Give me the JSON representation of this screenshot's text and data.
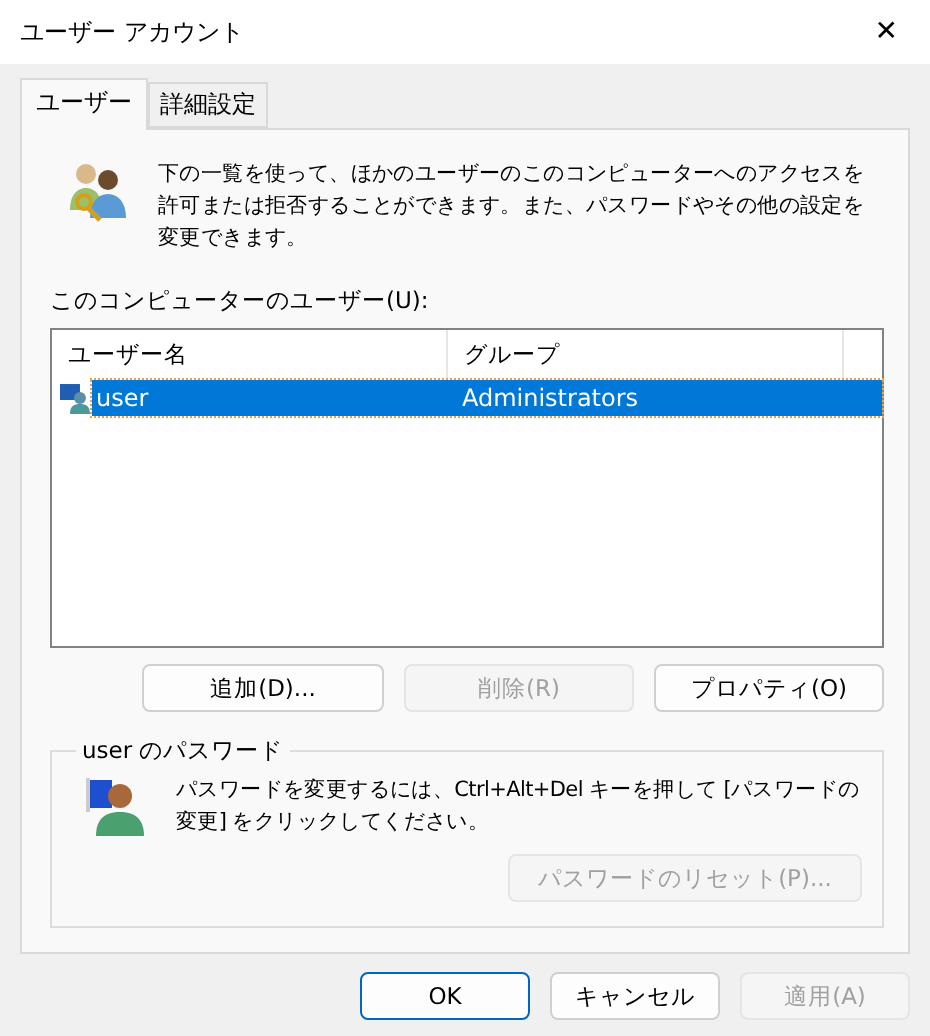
{
  "window": {
    "title": "ユーザー アカウント",
    "close": "✕"
  },
  "tabs": [
    {
      "label": "ユーザー",
      "selected": true
    },
    {
      "label": "詳細設定",
      "selected": false
    }
  ],
  "intro": "下の一覧を使って、ほかのユーザーのこのコンピューターへのアクセスを許可または拒否することができます。また、パスワードやその他の設定を変更できます。",
  "users_label": "このコンピューターのユーザー(U):",
  "table": {
    "columns": [
      "ユーザー名",
      "グループ"
    ],
    "rows": [
      {
        "cells": [
          "user",
          "Administrators"
        ],
        "selected": true
      }
    ]
  },
  "user_buttons": [
    {
      "label": "追加(D)...",
      "disabled": false
    },
    {
      "label": "削除(R)",
      "disabled": true
    },
    {
      "label": "プロパティ(O)",
      "disabled": false
    }
  ],
  "password_group": {
    "title": "user のパスワード",
    "text": "パスワードを変更するには、Ctrl+Alt+Del キーを押して [パスワードの変更] をクリックしてください。",
    "button": {
      "label": "パスワードのリセット(P)...",
      "disabled": true
    }
  },
  "dialog_buttons": [
    {
      "label": "OK",
      "disabled": false,
      "default": true
    },
    {
      "label": "キャンセル",
      "disabled": false,
      "default": false
    },
    {
      "label": "適用(A)",
      "disabled": true,
      "default": false
    }
  ]
}
